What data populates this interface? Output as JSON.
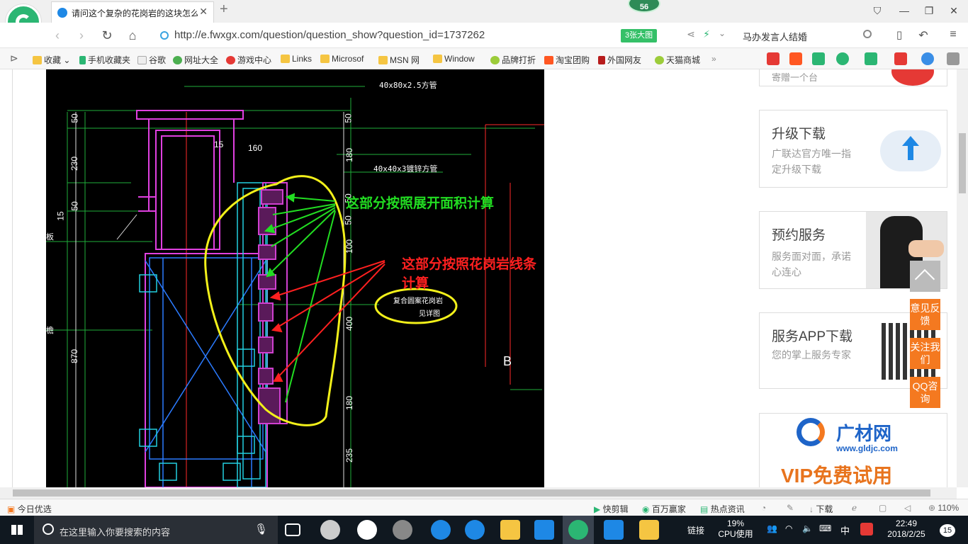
{
  "browser": {
    "tab_title": "请问这个复杂的花岗岩的这块怎么",
    "badge_count": "56",
    "url": "http://e.fwxgx.com/question/question_show?question_id=1737262",
    "big_image_button": "3张大图",
    "search_text": "马办发言人结婚"
  },
  "bookmarks": [
    {
      "label": "收藏",
      "icon": "star-icon"
    },
    {
      "label": "手机收藏夹",
      "icon": "phone-icon"
    },
    {
      "label": "谷歌",
      "icon": "page-icon"
    },
    {
      "label": "网址大全",
      "icon": "globe-icon"
    },
    {
      "label": "游戏中心",
      "icon": "game-icon"
    },
    {
      "label": "Links",
      "icon": "folder-icon"
    },
    {
      "label": "Microsof",
      "icon": "folder-icon"
    },
    {
      "label": "MSN 网",
      "icon": "folder-icon"
    },
    {
      "label": "Window",
      "icon": "folder-icon"
    },
    {
      "label": "品牌打折",
      "icon": "leaf-icon"
    },
    {
      "label": "淘宝团购",
      "icon": "taobao-icon"
    },
    {
      "label": "外国网友",
      "icon": "bookmark-icon"
    },
    {
      "label": "天猫商城",
      "icon": "leaf-icon"
    }
  ],
  "drawing": {
    "annotation_green": "这部分按照展开面积计算",
    "annotation_red": "这部分按照花岗岩线条计算",
    "callout_line1": "复合圆案花岗岩",
    "callout_line2": "见详图",
    "label_pipe_top": "40x80x2.5方管",
    "label_pipe_mid": "40x40x3镀锌方管",
    "dim_160": "160",
    "dim_15": "15",
    "letter_b": "B",
    "left_label": "檐",
    "left_label2": "板",
    "left_dims": [
      "50",
      "230",
      "50",
      "15",
      "870"
    ],
    "right_dims": [
      "50",
      "180",
      "50",
      "50",
      "100",
      "400",
      "180",
      "235"
    ]
  },
  "sidebar": {
    "card_top_partial": "寄赠一个台",
    "upgrade": {
      "title": "升级下载",
      "desc": "广联达官方唯一指定升级下载"
    },
    "appointment": {
      "title": "预约服务",
      "desc": "服务面对面，承诺心连心"
    },
    "app": {
      "title": "服务APP下载",
      "desc": "您的掌上服务专家"
    },
    "ad": {
      "brand": "广材网",
      "domain": "www.gldjc.com",
      "slogan": "VIP免费试用"
    },
    "float_buttons": [
      "意见反馈",
      "关注我们",
      "QQ咨询"
    ]
  },
  "statusbar": {
    "left": "今日优选",
    "items": [
      "快剪辑",
      "百万赢家",
      "热点资讯",
      "下载"
    ],
    "zoom": "110%"
  },
  "taskbar": {
    "search_placeholder": "在这里输入你要搜索的内容",
    "link_label": "链接",
    "cpu_percent": "19%",
    "cpu_label": "CPU使用",
    "ime": "中",
    "time": "22:49",
    "date": "2018/2/25",
    "notification_count": "15"
  },
  "colors": {
    "green_annotation": "#22dd22",
    "red_annotation": "#ff2020",
    "yellow_outline": "#f2f01a",
    "orange_button": "#f47920",
    "drawing_bg": "#000000"
  }
}
